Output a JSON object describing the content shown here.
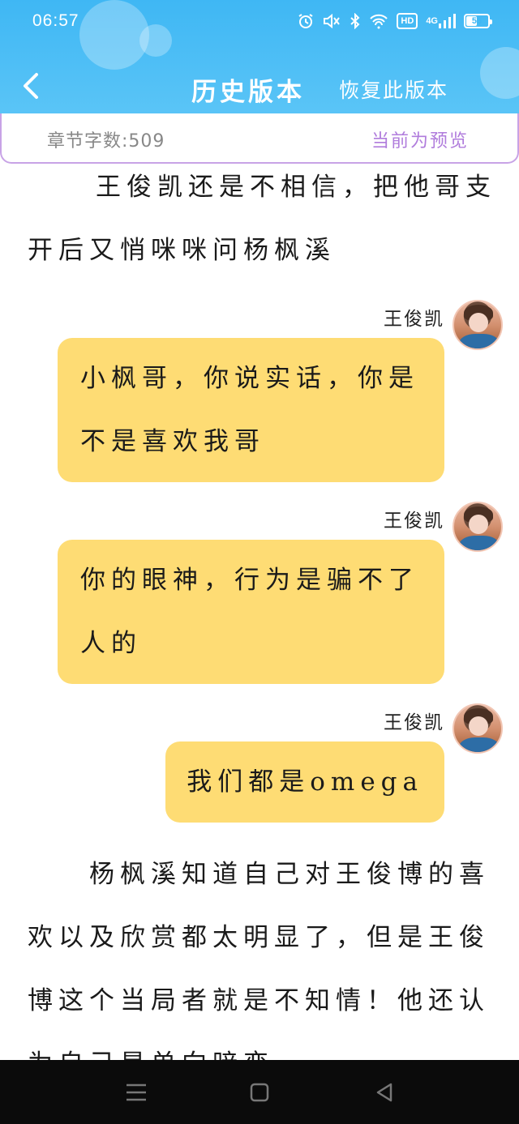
{
  "status_bar": {
    "time": "06:57",
    "hd_label": "HD",
    "signal_label": "4G",
    "battery_percent": 55
  },
  "header": {
    "title": "历史版本",
    "restore_label": "恢复此版本",
    "background_color": "#4bbcf5"
  },
  "info": {
    "word_count": "章节字数:509",
    "preview_label": "当前为预览"
  },
  "content": {
    "para_1": "王俊凯还是不相信，把他哥支开后又悄咪咪问杨枫溪",
    "messages": [
      {
        "speaker": "王俊凯",
        "text": "小枫哥，你说实话，你是不是喜欢我哥"
      },
      {
        "speaker": "王俊凯",
        "text": "你的眼神，行为是骗不了人的"
      },
      {
        "speaker": "王俊凯",
        "text": "我们都是omega"
      }
    ],
    "para_2": "杨枫溪知道自己对王俊博的喜欢以及欣赏都太明显了，但是王俊博这个当局者就是不知情！他还认为自己是单向暗恋"
  },
  "colors": {
    "bubble": "#fedc74",
    "accent_purple": "#b07cdc"
  },
  "icons": {
    "back": "chevron-left-icon",
    "alarm": "alarm-icon",
    "mute": "mute-icon",
    "bluetooth": "bluetooth-icon",
    "wifi": "wifi-icon",
    "menu": "menu-icon",
    "home": "home-icon",
    "sys_back": "triangle-back-icon"
  }
}
